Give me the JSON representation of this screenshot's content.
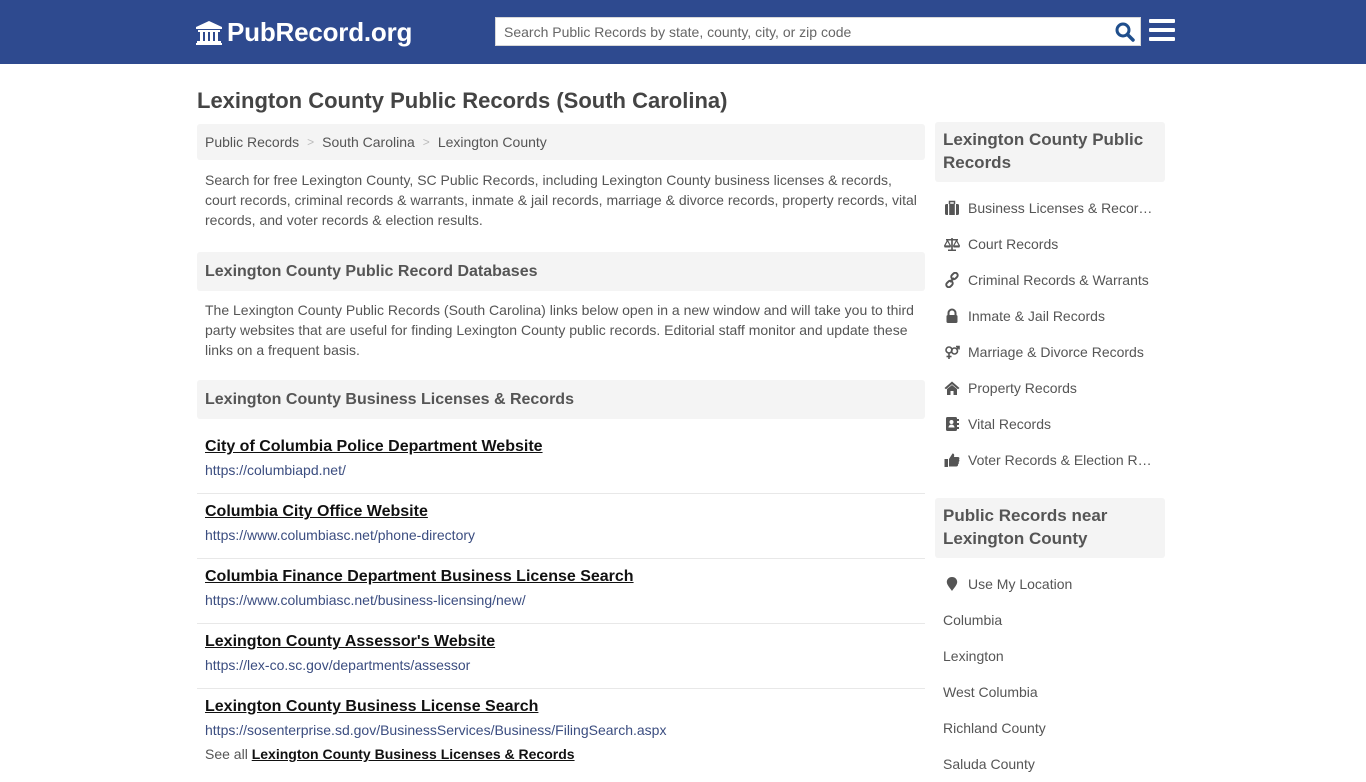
{
  "header": {
    "logo_text": "PubRecord.org",
    "search_placeholder": "Search Public Records by state, county, city, or zip code",
    "search_value": "",
    "colors": {
      "bar": "#2e4a8f",
      "search_icon": "#1f4e8c"
    }
  },
  "page": {
    "title": "Lexington County Public Records (South Carolina)"
  },
  "breadcrumb": [
    {
      "label": "Public Records"
    },
    {
      "label": "South Carolina"
    },
    {
      "label": "Lexington County"
    }
  ],
  "breadcrumb_separator": ">",
  "intro": "Search for free Lexington County, SC Public Records, including Lexington County business licenses & records, court records, criminal records & warrants, inmate & jail records, marriage & divorce records, property records, vital records, and voter records & election results.",
  "databases": {
    "heading": "Lexington County Public Record Databases",
    "description": "The Lexington County Public Records (South Carolina) links below open in a new window and will take you to third party websites that are useful for finding Lexington County public records. Editorial staff monitor and update these links on a frequent basis."
  },
  "business": {
    "heading": "Lexington County Business Licenses & Records",
    "links": [
      {
        "title": "City of Columbia Police Department Website",
        "url": "https://columbiapd.net/"
      },
      {
        "title": "Columbia City Office Website",
        "url": "https://www.columbiasc.net/phone-directory"
      },
      {
        "title": "Columbia Finance Department Business License Search",
        "url": "https://www.columbiasc.net/business-licensing/new/"
      },
      {
        "title": "Lexington County Assessor's Website",
        "url": "https://lex-co.sc.gov/departments/assessor"
      },
      {
        "title": "Lexington County Business License Search",
        "url": "https://sosenterprise.sd.gov/BusinessServices/Business/FilingSearch.aspx"
      }
    ],
    "see_all_prefix": "See all",
    "see_all_link": "Lexington County Business Licenses & Records"
  },
  "sidebar": {
    "records_heading": "Lexington County Public Records",
    "records": [
      {
        "icon": "briefcase-icon",
        "label": "Business Licenses & Records"
      },
      {
        "icon": "scale-icon",
        "label": "Court Records"
      },
      {
        "icon": "link-icon",
        "label": "Criminal Records & Warrants"
      },
      {
        "icon": "lock-icon",
        "label": "Inmate & Jail Records"
      },
      {
        "icon": "venus-mars-icon",
        "label": "Marriage & Divorce Records"
      },
      {
        "icon": "home-icon",
        "label": "Property Records"
      },
      {
        "icon": "address-book-icon",
        "label": "Vital Records"
      },
      {
        "icon": "thumbs-up-icon",
        "label": "Voter Records & Election Results"
      }
    ],
    "near_heading": "Public Records near Lexington County",
    "use_location": "Use My Location",
    "near": [
      {
        "label": "Columbia"
      },
      {
        "label": "Lexington"
      },
      {
        "label": "West Columbia"
      },
      {
        "label": "Richland County"
      },
      {
        "label": "Saluda County"
      }
    ]
  }
}
